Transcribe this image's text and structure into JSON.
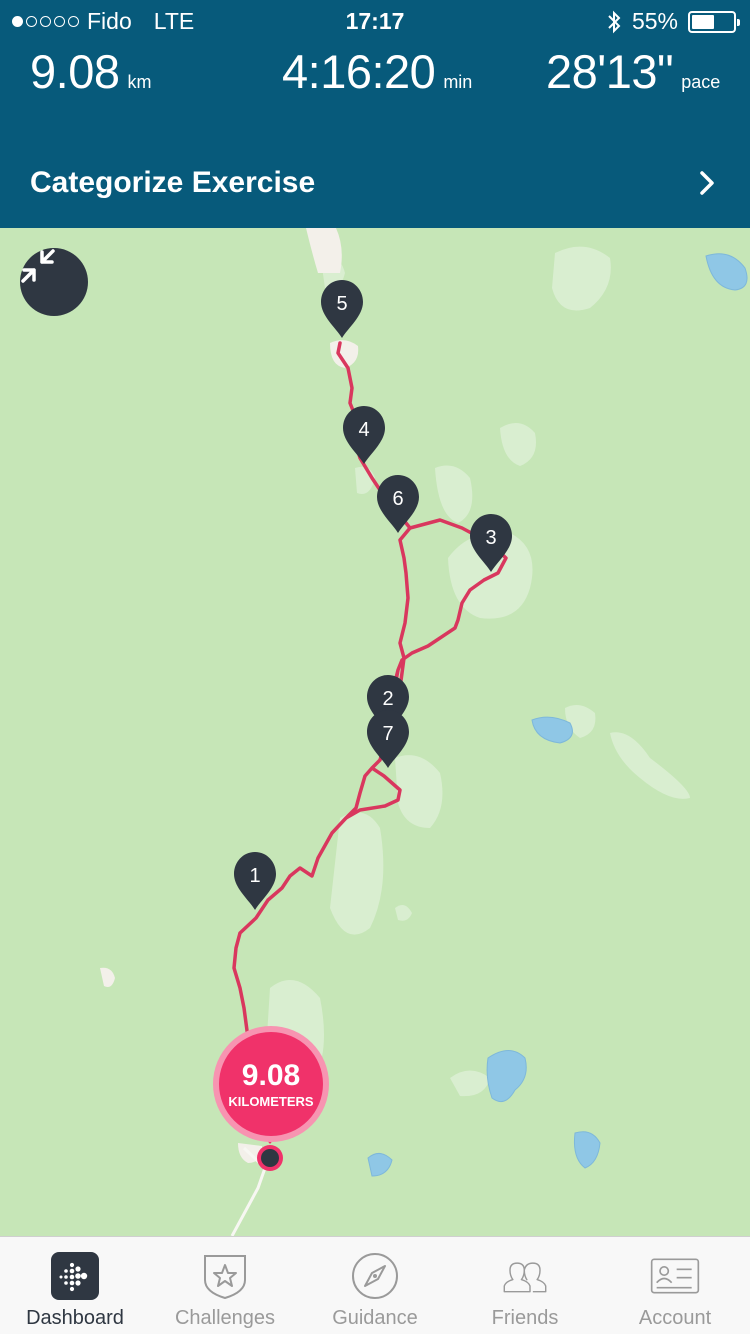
{
  "status_bar": {
    "carrier": "Fido",
    "network": "LTE",
    "time": "17:17",
    "battery": "55%",
    "battery_level": 0.55
  },
  "stats": {
    "distance": {
      "value": "9.08",
      "unit": "km"
    },
    "duration": {
      "value": "4:16:20",
      "unit": "min"
    },
    "pace": {
      "value": "28'13\"",
      "unit": "pace"
    }
  },
  "categorize": {
    "label": "Categorize Exercise"
  },
  "map": {
    "markers": [
      "5",
      "4",
      "6",
      "3",
      "2",
      "7",
      "1"
    ],
    "distance_badge": {
      "value": "9.08",
      "unit": "KILOMETERS"
    }
  },
  "tabs": [
    {
      "label": "Dashboard",
      "icon": "dashboard-icon",
      "active": true
    },
    {
      "label": "Challenges",
      "icon": "star-badge-icon",
      "active": false
    },
    {
      "label": "Guidance",
      "icon": "compass-icon",
      "active": false
    },
    {
      "label": "Friends",
      "icon": "friends-icon",
      "active": false
    },
    {
      "label": "Account",
      "icon": "account-card-icon",
      "active": false
    }
  ],
  "colors": {
    "header": "#075a7b",
    "map_land": "#c6e6b7",
    "route": "#d9375e",
    "accent": "#f0326a",
    "marker": "#2f3742"
  }
}
